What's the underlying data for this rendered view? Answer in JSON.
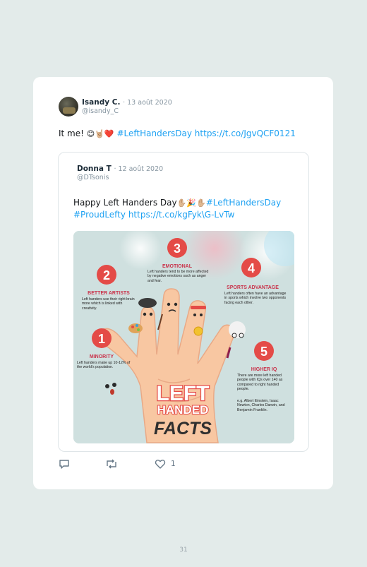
{
  "tweet": {
    "author_name": "Isandy C.",
    "date": "· 13 août 2020",
    "handle": "@isandy_C",
    "text_prefix": "It me! ",
    "emojis": "😊🤘🏼❤️",
    "hashtag": "#LeftHandersDay",
    "link": "https://t.co/JgvQCF0121"
  },
  "quoted": {
    "author_name": "Donna T",
    "date": "· 12 août 2020",
    "handle": "@DTsonis",
    "text_prefix": "Happy Left Handers Day",
    "emojis": "✋🏼🎉✋🏼",
    "hashtag1": "#LeftHandersDay",
    "hashtag2": "#ProudLefty",
    "link": "https://t.co/kgFyk\\G-LvTw"
  },
  "infographic": {
    "n1": "1",
    "t1": "MINORITY",
    "d1": "Left handers make up 10-12% of the world's population.",
    "n2": "2",
    "t2": "BETTER ARTISTS",
    "d2": "Left handers use their right brain more which is linked with creativity.",
    "n3": "3",
    "t3": "EMOTIONAL",
    "d3": "Left handers tend to be more affected by negative emotions such as anger and fear.",
    "n4": "4",
    "t4": "SPORTS ADVANTAGE",
    "d4": "Left handers often have an advantage in sports which involve two opponents facing each other.",
    "n5": "5",
    "t5": "HIGHER IQ",
    "d5": "There are more left handed people with IQs over 140 as compared to right handed people.",
    "d5b": "e.g. Albert Einstein, Isaac Newton, Charles Darwin, and Benjamin Franklin.",
    "big1": "LEFT",
    "big2": "HANDED",
    "big3": "FACTS",
    "colors": {
      "red": "#e44b47",
      "skin": "#f8c7a2",
      "bg": "#cfe0df"
    }
  },
  "actions": {
    "reply_icon": "reply-icon",
    "retweet_icon": "retweet-icon",
    "like_icon": "heart-icon",
    "like_count": "1"
  },
  "page_number": "31"
}
